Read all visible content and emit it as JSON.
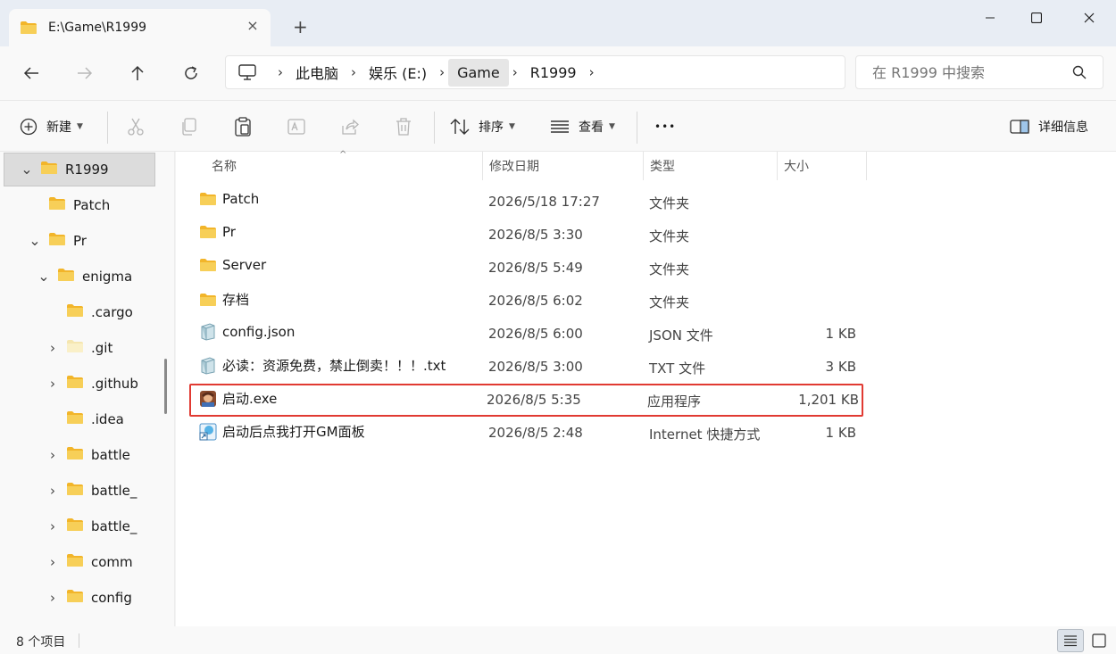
{
  "window": {
    "tab_title": "E:\\Game\\R1999",
    "tab_close": "×",
    "new_tab": "+"
  },
  "address": {
    "crumbs": [
      "此电脑",
      "娱乐 (E:)",
      "Game",
      "R1999"
    ],
    "separator": "›"
  },
  "search": {
    "placeholder": "在 R1999 中搜索"
  },
  "toolbar": {
    "new_label": "新建",
    "sort_label": "排序",
    "view_label": "查看",
    "more_label": "•••",
    "details_label": "详细信息"
  },
  "sidebar": {
    "items": [
      {
        "label": "R1999",
        "indent": 1,
        "chevron": "expanded",
        "selected": true
      },
      {
        "label": "Patch",
        "indent": 2,
        "chevron": "none"
      },
      {
        "label": "Pr",
        "indent": 2,
        "chevron": "expanded"
      },
      {
        "label": "enigma",
        "indent": 3,
        "chevron": "expanded"
      },
      {
        "label": ".cargo",
        "indent": 4,
        "chevron": "none"
      },
      {
        "label": ".git",
        "indent": 4,
        "chevron": "collapsed",
        "faded": true
      },
      {
        "label": ".github",
        "indent": 4,
        "chevron": "collapsed"
      },
      {
        "label": ".idea",
        "indent": 4,
        "chevron": "none"
      },
      {
        "label": "battle",
        "indent": 4,
        "chevron": "collapsed"
      },
      {
        "label": "battle_",
        "indent": 4,
        "chevron": "collapsed"
      },
      {
        "label": "battle_",
        "indent": 4,
        "chevron": "collapsed"
      },
      {
        "label": "comm",
        "indent": 4,
        "chevron": "collapsed"
      },
      {
        "label": "config",
        "indent": 4,
        "chevron": "collapsed"
      }
    ]
  },
  "columns": {
    "name": "名称",
    "date": "修改日期",
    "type": "类型",
    "size": "大小",
    "sort_indicator": "^"
  },
  "files": [
    {
      "name": "Patch",
      "date": "2026/5/18 17:27",
      "type": "文件夹",
      "size": "",
      "icon": "folder-icon"
    },
    {
      "name": "Pr",
      "date": "2026/8/5 3:30",
      "type": "文件夹",
      "size": "",
      "icon": "folder-icon"
    },
    {
      "name": "Server",
      "date": "2026/8/5 5:49",
      "type": "文件夹",
      "size": "",
      "icon": "folder-icon"
    },
    {
      "name": "存档",
      "date": "2026/8/5 6:02",
      "type": "文件夹",
      "size": "",
      "icon": "folder-icon"
    },
    {
      "name": "config.json",
      "date": "2026/8/5 6:00",
      "type": "JSON 文件",
      "size": "1 KB",
      "icon": "json-file-icon"
    },
    {
      "name": "必读：资源免费，禁止倒卖！！！.txt",
      "date": "2026/8/5 3:00",
      "type": "TXT 文件",
      "size": "3 KB",
      "icon": "text-file-icon"
    },
    {
      "name": "启动.exe",
      "date": "2026/8/5 5:35",
      "type": "应用程序",
      "size": "1,201 KB",
      "icon": "game-exe-icon",
      "highlighted": true
    },
    {
      "name": "启动后点我打开GM面板",
      "date": "2026/8/5 2:48",
      "type": "Internet 快捷方式",
      "size": "1 KB",
      "icon": "internet-shortcut-icon"
    }
  ],
  "status": {
    "item_count": "8 个项目"
  },
  "colors": {
    "highlight_border": "#e13a32",
    "folder": "#f7c948",
    "selection": "#dcdcdc"
  }
}
